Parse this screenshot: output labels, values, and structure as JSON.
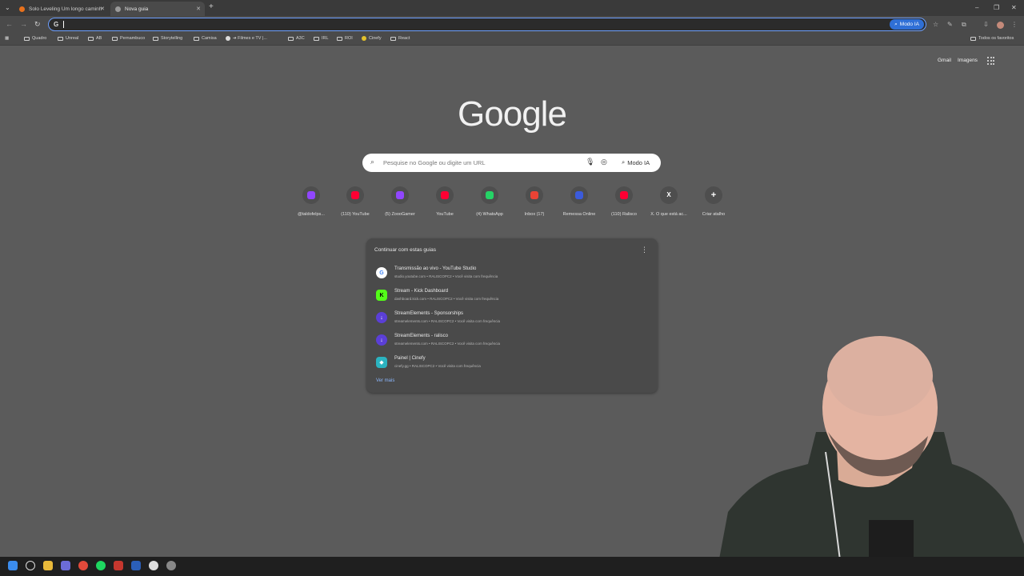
{
  "tabs": [
    {
      "title": "Solo Leveling Um longo caminh",
      "active": false
    },
    {
      "title": "Nova guia",
      "active": true
    }
  ],
  "toolbar": {
    "omnibox_value": "",
    "modo_ia_label": "Modo IA"
  },
  "bookmarks": {
    "items": [
      "Quadro",
      "Unreal",
      "AB",
      "Pernambuco",
      "Storytelling",
      "Camisa",
      "➔ Filmes e TV |...",
      "A3C",
      "IRL",
      "ROI",
      "Cinefy",
      "React"
    ],
    "all_favorites": "Todos os favoritos"
  },
  "header": {
    "gmail": "Gmail",
    "images": "Imagens"
  },
  "logo": "Google",
  "search": {
    "placeholder": "Pesquise no Google ou digite um URL",
    "modo_ia": "Modo IA"
  },
  "shortcuts": [
    {
      "label": "@taldofelps...",
      "icon": "twitch-icon",
      "color": "#9146ff"
    },
    {
      "label": "(110) YouTube",
      "icon": "youtube-icon",
      "color": "#ff0033"
    },
    {
      "label": "(5) ZoooGamer",
      "icon": "twitch-icon",
      "color": "#9146ff"
    },
    {
      "label": "YouTube",
      "icon": "youtube-icon",
      "color": "#ff0033"
    },
    {
      "label": "(4) WhatsApp",
      "icon": "whatsapp-icon",
      "color": "#25d366"
    },
    {
      "label": "Inbox (17)",
      "icon": "gmail-icon",
      "color": "#ea4335"
    },
    {
      "label": "Remessa Online",
      "icon": "remessa-icon",
      "color": "#3b5bdb"
    },
    {
      "label": "(110) Ralisco",
      "icon": "youtube-icon",
      "color": "#ff0033"
    },
    {
      "label": "X. O que está ac...",
      "icon": "x-icon",
      "color": "#000000"
    },
    {
      "label": "Criar atalho",
      "icon": "plus-icon",
      "color": "#4e4e4e"
    }
  ],
  "continue": {
    "title": "Continuar com estas guias",
    "items": [
      {
        "title": "Transmissão ao vivo - YouTube Studio",
        "meta": "studio.youtube.com • RALISCOPC2 • Você visita com frequência",
        "icon": "google-icon",
        "color": "#ffffff"
      },
      {
        "title": "Stream - Kick Dashboard",
        "meta": "dashboard.kick.com • RALISCOPC2 • Você visita com frequência",
        "icon": "kick-icon",
        "color": "#53fc18"
      },
      {
        "title": "StreamElements - Sponsorships",
        "meta": "streamelements.com • RALISCOPC2 • Você visita com frequência",
        "icon": "streamelements-icon",
        "color": "#5b3fd6"
      },
      {
        "title": "StreamElements - ralisco",
        "meta": "streamelements.com • RALISCOPC2 • Você visita com frequência",
        "icon": "streamelements-icon",
        "color": "#5b3fd6"
      },
      {
        "title": "Painel | Cinefy",
        "meta": "cinefy.gg • RALISCOPC2 • Você visita com frequência",
        "icon": "cinefy-icon",
        "color": "#2bb3c0"
      }
    ],
    "see_more": "Ver mais"
  }
}
